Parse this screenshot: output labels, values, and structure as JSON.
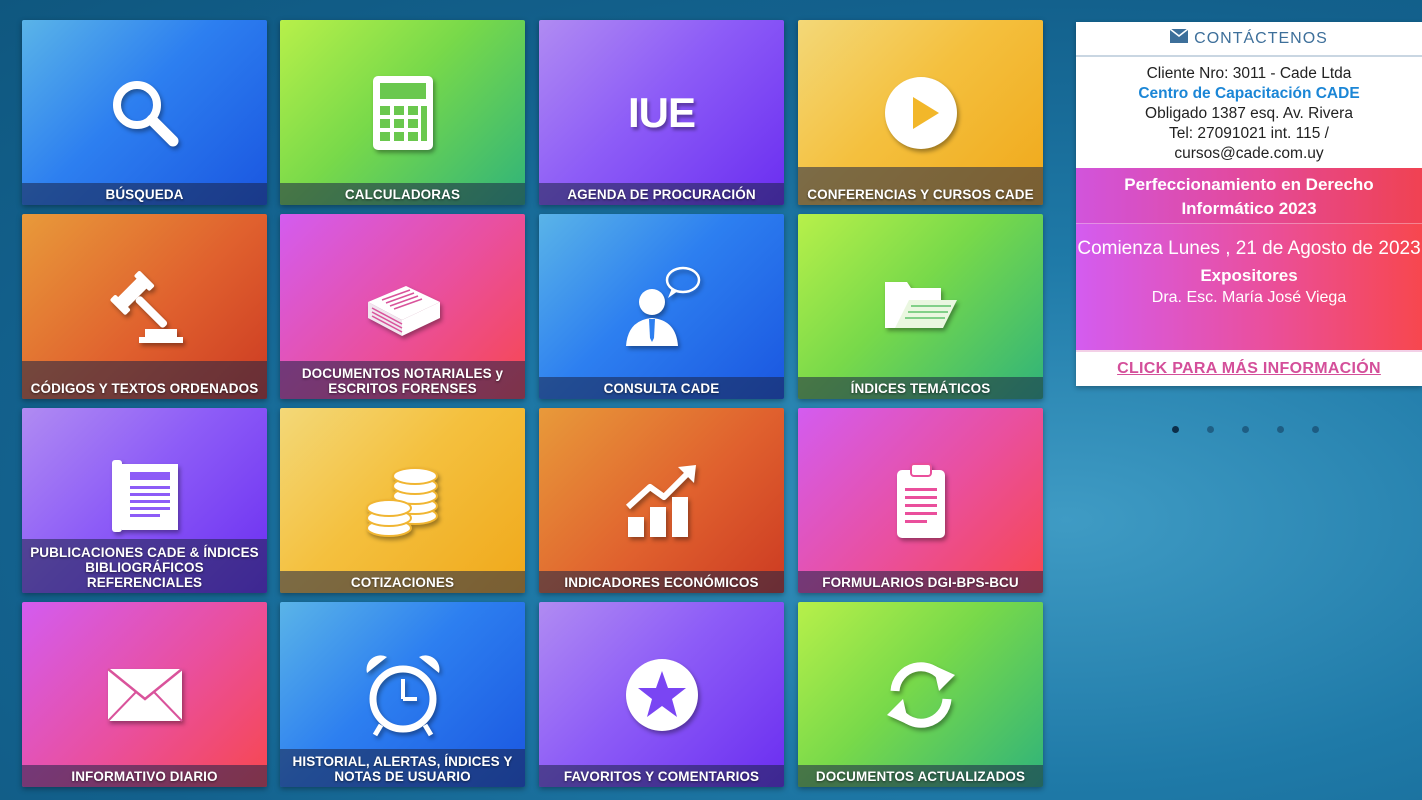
{
  "tiles": [
    {
      "label": "BÚSQUEDA",
      "icon": "search-icon"
    },
    {
      "label": "CALCULADORAS",
      "icon": "calculator-icon"
    },
    {
      "label": "AGENDA DE PROCURACIÓN",
      "icon": "iue-text-icon",
      "icon_text": "IUE"
    },
    {
      "label": "CONFERENCIAS Y CURSOS CADE",
      "icon": "play-icon"
    },
    {
      "label": "CÓDIGOS Y TEXTOS ORDENADOS",
      "icon": "gavel-icon"
    },
    {
      "label": "DOCUMENTOS NOTARIALES y ESCRITOS FORENSES",
      "icon": "document-stack-icon"
    },
    {
      "label": "CONSULTA CADE",
      "icon": "consultant-icon"
    },
    {
      "label": "ÍNDICES TEMÁTICOS",
      "icon": "folder-open-icon"
    },
    {
      "label": "PUBLICACIONES CADE & ÍNDICES BIBLIOGRÁFICOS REFERENCIALES",
      "icon": "newspaper-icon"
    },
    {
      "label": "COTIZACIONES",
      "icon": "coins-icon"
    },
    {
      "label": "INDICADORES ECONÓMICOS",
      "icon": "growth-chart-icon"
    },
    {
      "label": "FORMULARIOS DGI-BPS-BCU",
      "icon": "clipboard-icon"
    },
    {
      "label": "INFORMATIVO DIARIO",
      "icon": "envelope-icon"
    },
    {
      "label": "HISTORIAL, ALERTAS, ÍNDICES Y NOTAS DE USUARIO",
      "icon": "alarm-clock-icon"
    },
    {
      "label": "FAVORITOS Y COMENTARIOS",
      "icon": "star-icon"
    },
    {
      "label": "DOCUMENTOS ACTUALIZADOS",
      "icon": "refresh-icon"
    }
  ],
  "contact": {
    "heading": "CONTÁCTENOS",
    "client": "Cliente Nro: 3011 - Cade Ltda",
    "brand": "Centro de Capacitación CADE",
    "address": "Obligado 1387 esq. Av. Rivera",
    "phone": "Tel: 27091021 int. 115 /",
    "email": "cursos@cade.com.uy"
  },
  "promo": {
    "title": "Perfeccionamiento en Derecho Informático 2023",
    "date": "Comienza Lunes , 21 de Agosto de 2023",
    "speakers_title": "Expositores",
    "speaker": "Dra. Esc. María José Viega",
    "more_link": "CLICK PARA MÁS INFORMACIÓN"
  },
  "carousel": {
    "count": 5,
    "active": 0
  }
}
